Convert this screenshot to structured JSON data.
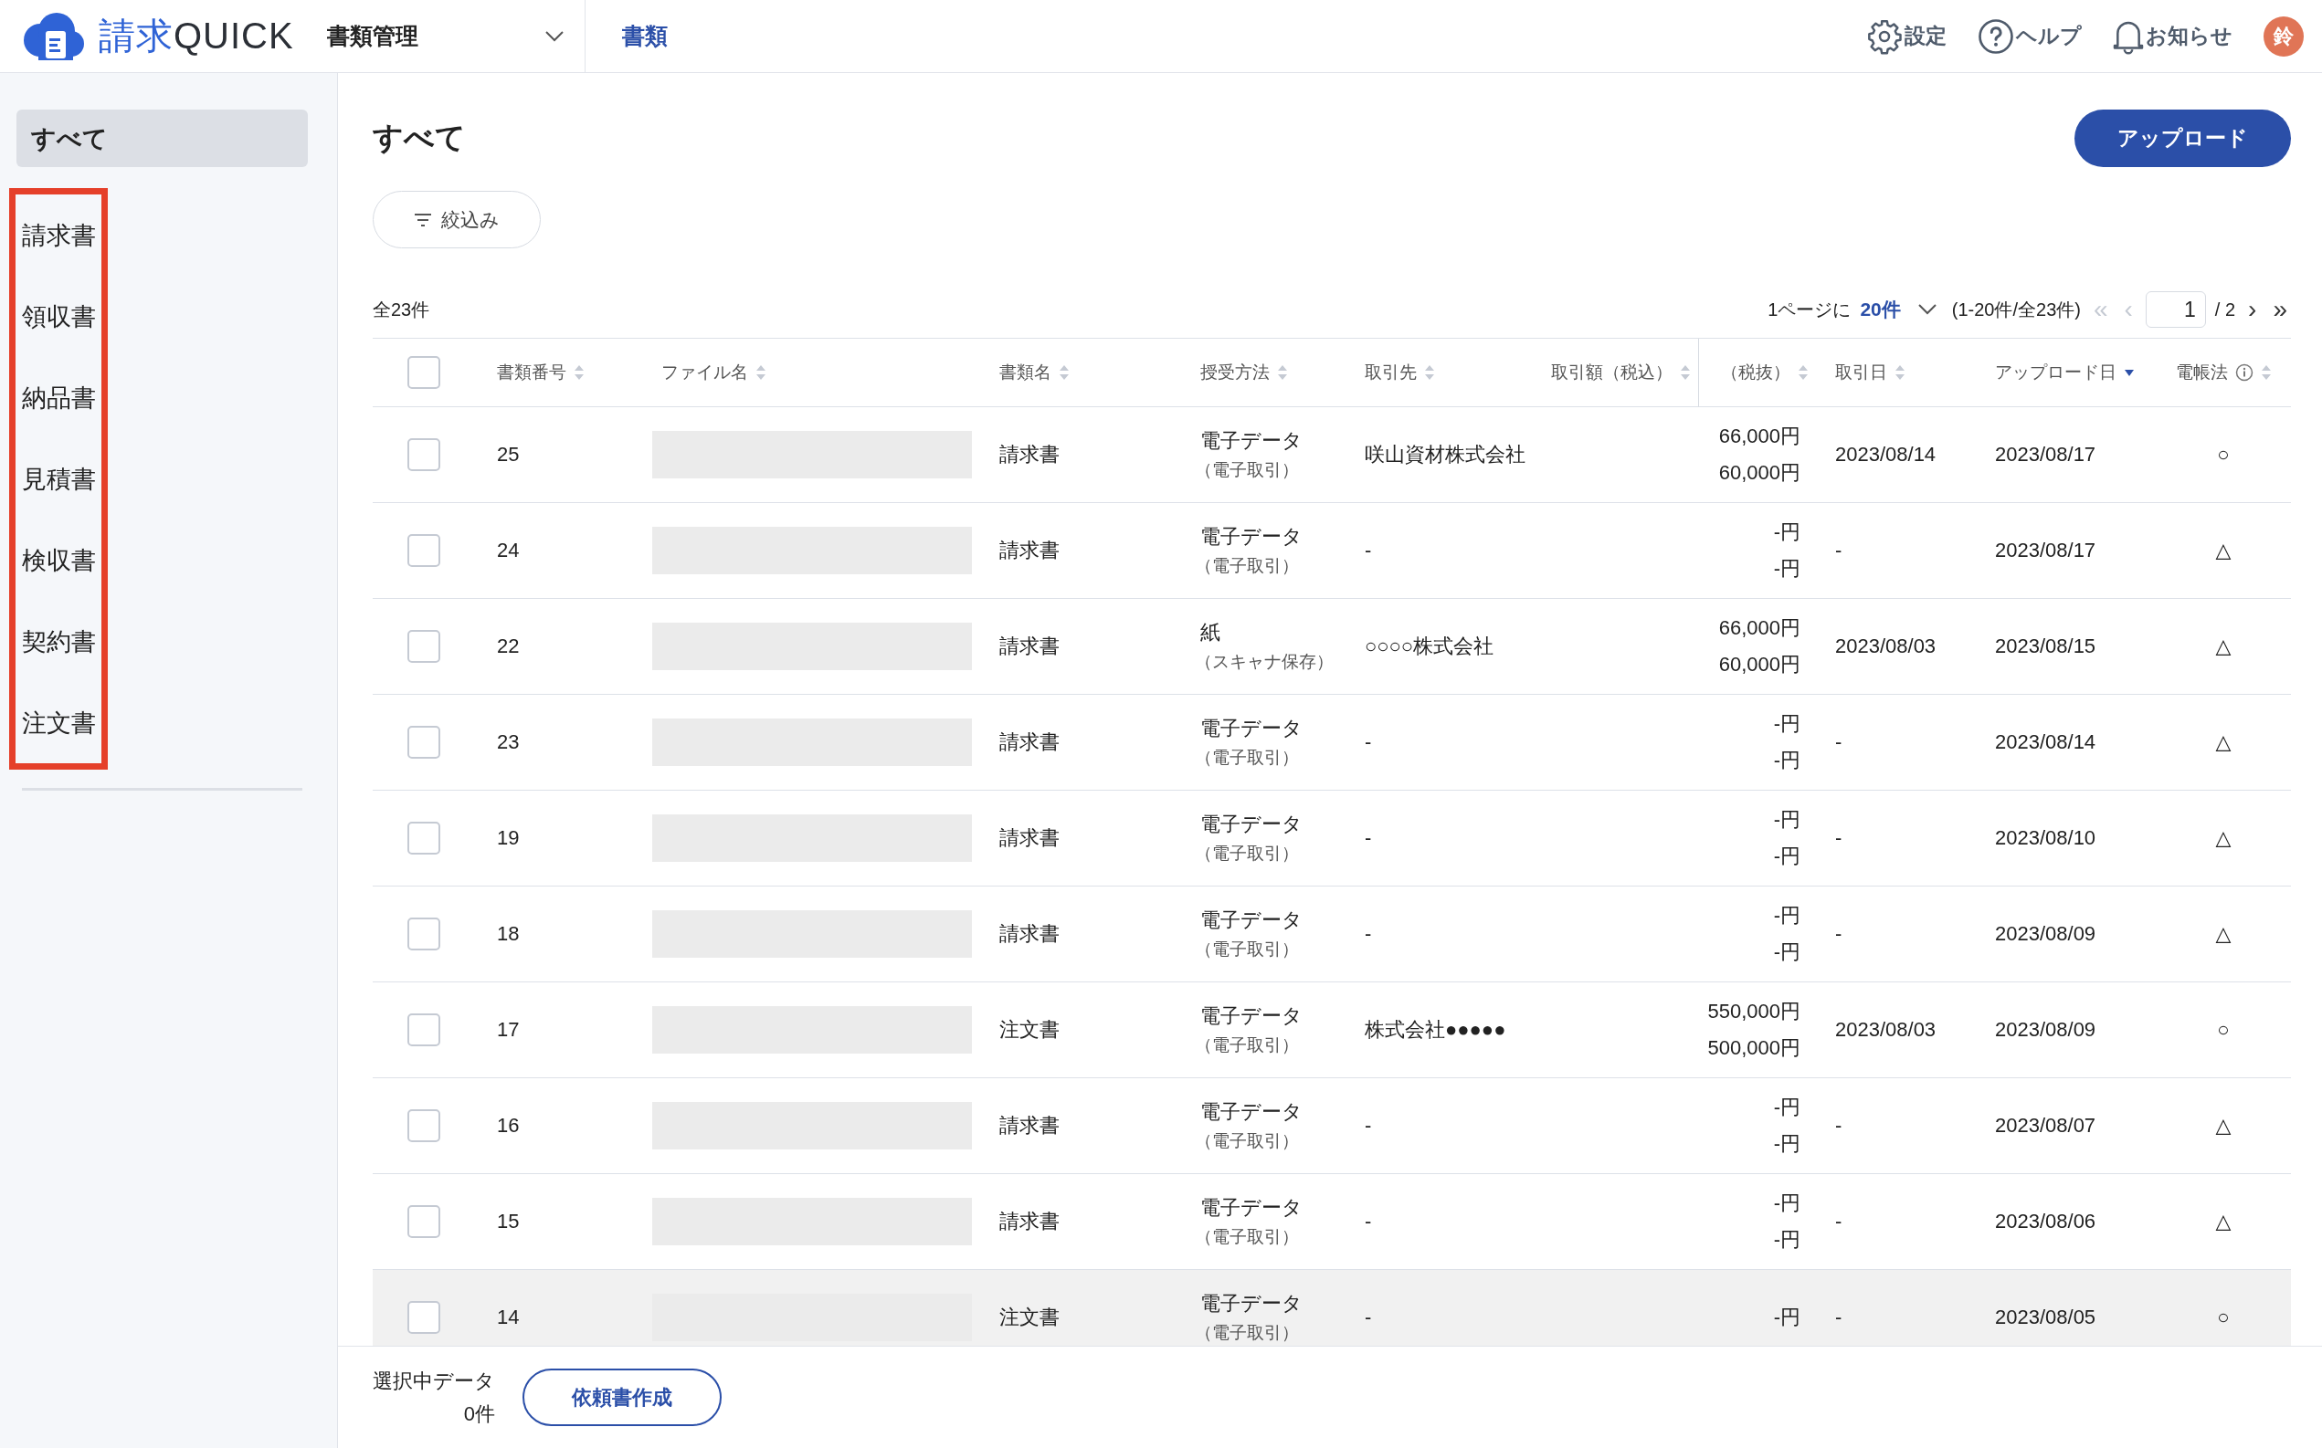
{
  "header": {
    "brand": [
      {
        "kind": "accent",
        "text": "請求"
      },
      {
        "kind": "plain",
        "text": "QUICK"
      }
    ],
    "module": "書類管理",
    "tabs": [
      {
        "label": "書類",
        "selected": true
      }
    ],
    "actions": [
      {
        "kind": "settings",
        "label": "設定"
      },
      {
        "kind": "help",
        "label": "ヘルプ"
      },
      {
        "kind": "notifications",
        "label": "お知らせ"
      }
    ],
    "avatar": "鈴"
  },
  "sidebar": {
    "items": [
      {
        "label": "すべて",
        "selected": true,
        "framed": false
      },
      {
        "label": "請求書",
        "selected": false,
        "framed": true
      },
      {
        "label": "領収書",
        "selected": false,
        "framed": true
      },
      {
        "label": "納品書",
        "selected": false,
        "framed": true
      },
      {
        "label": "見積書",
        "selected": false,
        "framed": true
      },
      {
        "label": "検収書",
        "selected": false,
        "framed": true
      },
      {
        "label": "契約書",
        "selected": false,
        "framed": true
      },
      {
        "label": "注文書",
        "selected": false,
        "framed": true
      }
    ]
  },
  "main": {
    "title": "すべて",
    "upload_button": "アップロード",
    "filter_button": "絞込み",
    "total": "全23件",
    "pagination": {
      "per_page_label": "1ページに",
      "per_page": "20件",
      "range": "(1-20件/全23件)",
      "page": "1",
      "pages": "/ 2",
      "nav": [
        {
          "symbol": "«",
          "disabled": true
        },
        {
          "symbol": "‹",
          "disabled": true
        },
        {
          "symbol": "›",
          "disabled": false
        },
        {
          "symbol": "»",
          "disabled": false
        }
      ]
    },
    "table": {
      "select_all": {
        "checked": false
      },
      "columns": [
        {
          "label": "書類番号",
          "sorted_desc": false,
          "info": false
        },
        {
          "label": "ファイル名",
          "sorted_desc": false,
          "info": false
        },
        {
          "label": "書類名",
          "sorted_desc": false,
          "info": false
        },
        {
          "label": "授受方法",
          "sorted_desc": false,
          "info": false
        },
        {
          "label": "取引先",
          "sorted_desc": false,
          "info": false
        },
        {
          "label": "取引額（税込）",
          "sorted_desc": false,
          "info": false
        },
        {
          "label": "（税抜）",
          "sorted_desc": false,
          "info": false
        },
        {
          "label": "取引日",
          "sorted_desc": false,
          "info": false
        },
        {
          "label": "アップロード日",
          "sorted_desc": true,
          "info": false
        },
        {
          "label": "電帳法",
          "sorted_desc": false,
          "info": true
        }
      ],
      "rows": [
        {
          "checked": false,
          "highlighted": false,
          "number": "25",
          "doc_name": "請求書",
          "method": "電子データ",
          "method_detail": "（電子取引）",
          "partner": "咲山資材株式会社",
          "amount_incl": "66,000円",
          "amount_excl": "60,000円",
          "trade_date": "2023/08/14",
          "upload_date": "2023/08/17",
          "compliance": "○"
        },
        {
          "checked": false,
          "highlighted": false,
          "number": "24",
          "doc_name": "請求書",
          "method": "電子データ",
          "method_detail": "（電子取引）",
          "partner": "-",
          "amount_incl": "-円",
          "amount_excl": "-円",
          "trade_date": "-",
          "upload_date": "2023/08/17",
          "compliance": "△"
        },
        {
          "checked": false,
          "highlighted": false,
          "number": "22",
          "doc_name": "請求書",
          "method": "紙",
          "method_detail": "（スキャナ保存）",
          "partner": "○○○○株式会社",
          "amount_incl": "66,000円",
          "amount_excl": "60,000円",
          "trade_date": "2023/08/03",
          "upload_date": "2023/08/15",
          "compliance": "△"
        },
        {
          "checked": false,
          "highlighted": false,
          "number": "23",
          "doc_name": "請求書",
          "method": "電子データ",
          "method_detail": "（電子取引）",
          "partner": "-",
          "amount_incl": "-円",
          "amount_excl": "-円",
          "trade_date": "-",
          "upload_date": "2023/08/14",
          "compliance": "△"
        },
        {
          "checked": false,
          "highlighted": false,
          "number": "19",
          "doc_name": "請求書",
          "method": "電子データ",
          "method_detail": "（電子取引）",
          "partner": "-",
          "amount_incl": "-円",
          "amount_excl": "-円",
          "trade_date": "-",
          "upload_date": "2023/08/10",
          "compliance": "△"
        },
        {
          "checked": false,
          "highlighted": false,
          "number": "18",
          "doc_name": "請求書",
          "method": "電子データ",
          "method_detail": "（電子取引）",
          "partner": "-",
          "amount_incl": "-円",
          "amount_excl": "-円",
          "trade_date": "-",
          "upload_date": "2023/08/09",
          "compliance": "△"
        },
        {
          "checked": false,
          "highlighted": false,
          "number": "17",
          "doc_name": "注文書",
          "method": "電子データ",
          "method_detail": "（電子取引）",
          "partner": "株式会社●●●●●",
          "amount_incl": "550,000円",
          "amount_excl": "500,000円",
          "trade_date": "2023/08/03",
          "upload_date": "2023/08/09",
          "compliance": "○"
        },
        {
          "checked": false,
          "highlighted": false,
          "number": "16",
          "doc_name": "請求書",
          "method": "電子データ",
          "method_detail": "（電子取引）",
          "partner": "-",
          "amount_incl": "-円",
          "amount_excl": "-円",
          "trade_date": "-",
          "upload_date": "2023/08/07",
          "compliance": "△"
        },
        {
          "checked": false,
          "highlighted": false,
          "number": "15",
          "doc_name": "請求書",
          "method": "電子データ",
          "method_detail": "（電子取引）",
          "partner": "-",
          "amount_incl": "-円",
          "amount_excl": "-円",
          "trade_date": "-",
          "upload_date": "2023/08/06",
          "compliance": "△"
        },
        {
          "checked": false,
          "highlighted": true,
          "number": "14",
          "doc_name": "注文書",
          "method": "電子データ",
          "method_detail": "（電子取引）",
          "partner": "-",
          "amount_incl": "-円",
          "trade_date": "-",
          "upload_date": "2023/08/05",
          "compliance": "○"
        }
      ]
    },
    "footer": {
      "selected_label": "選択中データ",
      "selected_count": "0件",
      "button": "依頼書作成"
    }
  }
}
